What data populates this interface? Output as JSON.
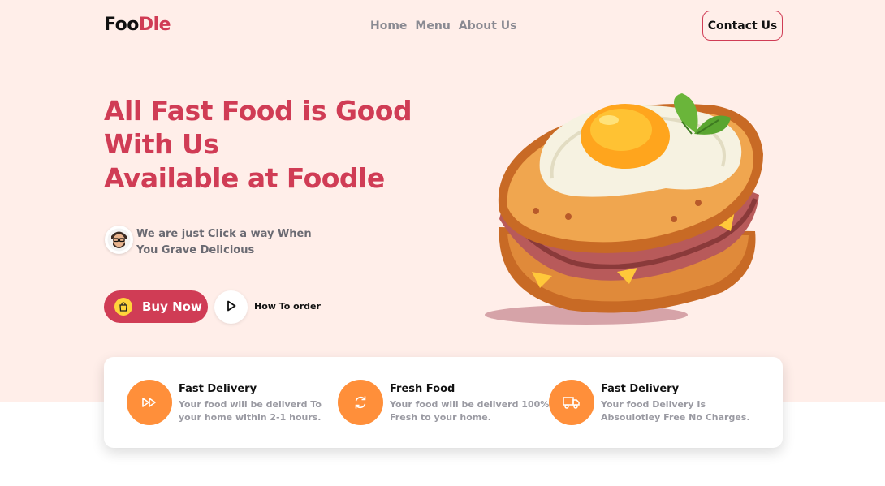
{
  "brand": {
    "part1": "Foo",
    "part2": "Dle",
    "accent_color": "#d03c55"
  },
  "nav": {
    "items": [
      "Home",
      "Menu",
      "About Us"
    ],
    "contact_label": "Contact Us"
  },
  "hero": {
    "title_line1": "All Fast Food is Good With Us",
    "title_line2": "Available at Foodle",
    "tagline": "We are just Click a way When You Grave Delicious",
    "buy_label": "Buy Now",
    "how_label": "How To order",
    "background": "#ffeee9"
  },
  "features": [
    {
      "icon": "fast-forward-icon",
      "title": "Fast Delivery",
      "desc": "Your food will be deliverd To your home within 2-1 hours."
    },
    {
      "icon": "refresh-icon",
      "title": "Fresh Food",
      "desc": "Your food will be deliverd 100% Fresh to your home."
    },
    {
      "icon": "truck-icon",
      "title": "Fast Delivery",
      "desc": "Your food Delivery Is Absoulotley Free No Charges."
    }
  ],
  "colors": {
    "icon_bg": "#ff8f3a",
    "button_yellow": "#ffd43b"
  }
}
